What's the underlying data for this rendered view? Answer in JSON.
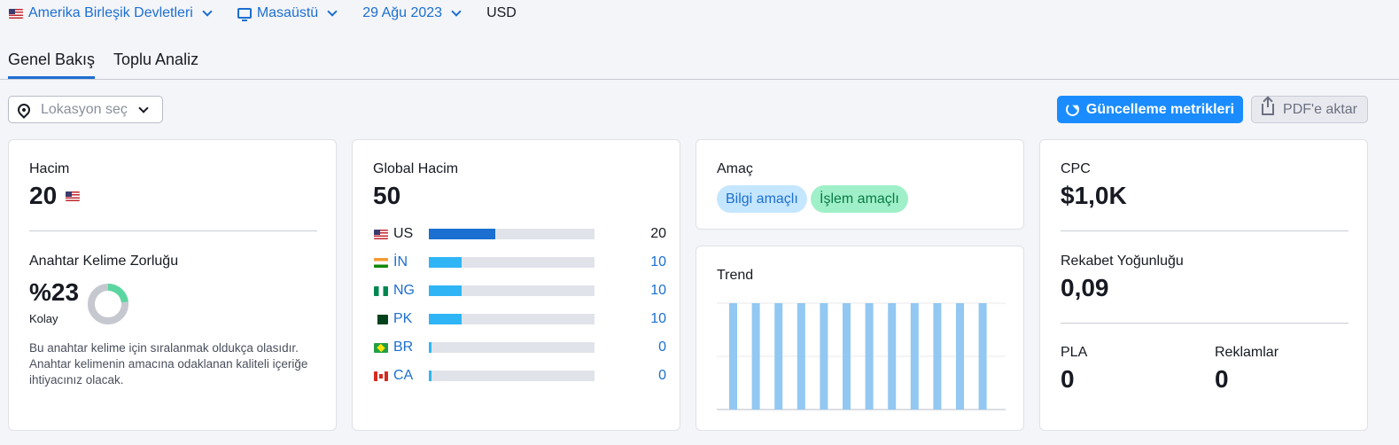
{
  "topbar": {
    "country": "Amerika Birleşik Devletleri",
    "device": "Masaüstü",
    "date": "29 Ağu 2023",
    "currency": "USD"
  },
  "tabs": [
    {
      "label": "Genel Bakış",
      "active": true
    },
    {
      "label": "Toplu Analiz",
      "active": false
    }
  ],
  "toolbar": {
    "location_placeholder": "Lokasyon seç",
    "update_label": "Güncelleme metrikleri",
    "export_label": "PDF'e aktar"
  },
  "volume": {
    "label": "Hacim",
    "value": "20"
  },
  "kd": {
    "label": "Anahtar Kelime Zorluğu",
    "value": "%23",
    "level": "Kolay",
    "percent": 23,
    "description": "Bu anahtar kelime için sıralanmak oldukça olasıdır. Anahtar kelimenin amacına odaklanan kaliteli içeriğe ihtiyacınız olacak.",
    "color": "#5cd6a0"
  },
  "global_volume": {
    "label": "Global Hacim",
    "value": "50",
    "rows": [
      {
        "code": "US",
        "value": "20",
        "share": 0.4
      },
      {
        "code": "İN",
        "value": "10",
        "share": 0.2
      },
      {
        "code": "NG",
        "value": "10",
        "share": 0.2
      },
      {
        "code": "PK",
        "value": "10",
        "share": 0.2
      },
      {
        "code": "BR",
        "value": "0",
        "share": 0.015
      },
      {
        "code": "CA",
        "value": "0",
        "share": 0.015
      }
    ]
  },
  "intent": {
    "label": "Amaç",
    "tags": [
      "Bilgi amaçlı",
      "İşlem amaçlı"
    ]
  },
  "trend": {
    "label": "Trend",
    "chart_data": {
      "type": "bar",
      "values": [
        1,
        1,
        1,
        1,
        1,
        1,
        1,
        1,
        1,
        1,
        1,
        1
      ],
      "ylim": [
        0,
        1
      ],
      "color": "#92c8f2"
    }
  },
  "cpc": {
    "label": "CPC",
    "value": "$1,0K"
  },
  "competition": {
    "label": "Rekabet Yoğunluğu",
    "value": "0,09"
  },
  "pla": {
    "label": "PLA",
    "value": "0"
  },
  "ads": {
    "label": "Reklamlar",
    "value": "0"
  },
  "colors": {
    "accent": "#1a8cff",
    "link": "#1c6fd0"
  }
}
